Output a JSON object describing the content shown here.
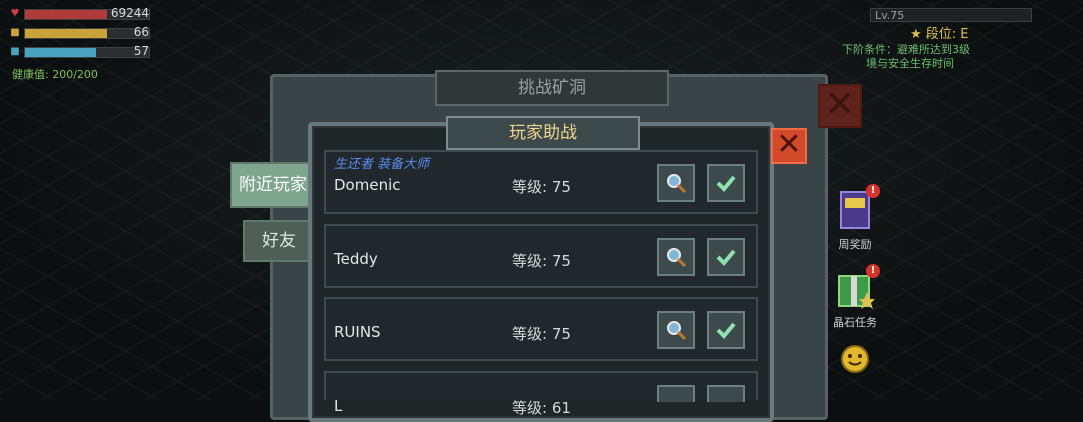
{
  "hud": {
    "hp_value": "69244",
    "stamina_value": "66",
    "water_value": "57",
    "health_text": "健康值: 200/200",
    "hp_color": "#b23a3a",
    "stamina_color": "#c7a33a",
    "water_color": "#4aa3c0"
  },
  "top_right": {
    "level": "Lv.75",
    "rank": "段位: E",
    "task_line1": "下阶条件：避难所达到3级",
    "task_line2": "境与安全生存时间"
  },
  "back_panel": {
    "title": "挑战矿洞"
  },
  "tabs": {
    "nearby": "附近玩家",
    "friends": "好友"
  },
  "panel": {
    "title": "玩家助战",
    "close_icon": "close-icon",
    "rows": [
      {
        "tags": "生还者  装备大师",
        "name": "Domenic",
        "level": "等级: 75"
      },
      {
        "tags": "",
        "name": "Teddy",
        "level": "等级: 75"
      },
      {
        "tags": "",
        "name": "RUINS",
        "level": "等级: 75"
      },
      {
        "tags": "",
        "name": "L",
        "level": "等级: 61"
      }
    ]
  },
  "side": {
    "weekly_reward": "周奖励",
    "crystal_task": "晶石任务",
    "badge": "!"
  }
}
